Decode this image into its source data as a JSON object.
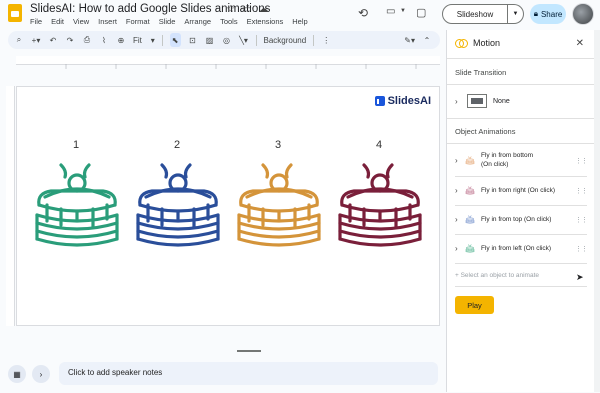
{
  "doc": {
    "title": "SlidesAI: How to add Google Slides animations",
    "menu": [
      "File",
      "Edit",
      "View",
      "Insert",
      "Format",
      "Slide",
      "Arrange",
      "Tools",
      "Extensions",
      "Help"
    ]
  },
  "header": {
    "slideshow_label": "Slideshow",
    "share_label": "Share"
  },
  "toolbar": {
    "zoom_label": "Fit",
    "background_label": "Background"
  },
  "slide": {
    "brand_text": "SlidesAI",
    "numbers": [
      "1",
      "2",
      "3",
      "4"
    ],
    "pancake_colors": [
      "#2a9d7a",
      "#2a4e9a",
      "#d4943a",
      "#7a1f3a"
    ]
  },
  "notes": {
    "placeholder": "Click to add speaker notes"
  },
  "panel": {
    "title": "Motion",
    "slide_transition_label": "Slide Transition",
    "transition_value": "None",
    "object_animations_label": "Object Animations",
    "animations": [
      {
        "line1": "Fly in from bottom",
        "line2": "(On click)",
        "color": "#e9b48a"
      },
      {
        "line1": "Fly in from right  (On click)",
        "line2": "",
        "color": "#c98aa0"
      },
      {
        "line1": "Fly in from top  (On click)",
        "line2": "",
        "color": "#8aa3d4"
      },
      {
        "line1": "Fly in from left  (On click)",
        "line2": "",
        "color": "#6fc0a3"
      }
    ],
    "select_hint": "+ Select an object to animate",
    "play_label": "Play"
  },
  "icons": {
    "star": "☆",
    "folder": "🗀",
    "cloud": "☁",
    "history": "⟲",
    "close": "✕"
  }
}
